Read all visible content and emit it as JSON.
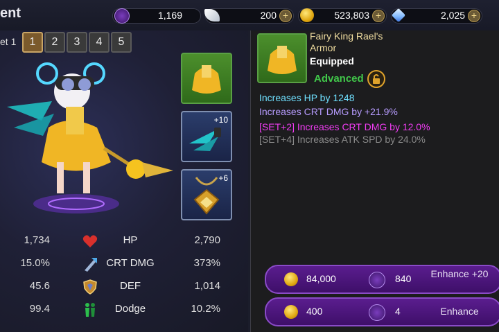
{
  "header": {
    "title": "ent",
    "currencies": [
      {
        "name": "armor-token",
        "value": "1,169",
        "has_plus": false
      },
      {
        "name": "feather",
        "value": "200",
        "has_plus": true
      },
      {
        "name": "gold",
        "value": "523,803",
        "has_plus": true
      },
      {
        "name": "diamond",
        "value": "2,025",
        "has_plus": true
      }
    ],
    "plus_label": "+"
  },
  "sets": {
    "label": "et 1",
    "buttons": [
      "1",
      "2",
      "3",
      "4",
      "5"
    ],
    "active": "1"
  },
  "slots": [
    {
      "name": "armor-slot",
      "level": ""
    },
    {
      "name": "wings-slot",
      "level": "+10"
    },
    {
      "name": "necklace-slot",
      "level": "+6"
    }
  ],
  "stats": [
    {
      "icon": "heart-icon",
      "left": "1,734",
      "label": "HP",
      "right": "2,790"
    },
    {
      "icon": "crit-damage-icon",
      "left": "15.0%",
      "label": "CRT DMG",
      "right": "373%"
    },
    {
      "icon": "shield-icon",
      "left": "45.6",
      "label": "DEF",
      "right": "1,014"
    },
    {
      "icon": "dodge-icon",
      "left": "99.4",
      "label": "Dodge",
      "right": "10.2%"
    }
  ],
  "item": {
    "name": "Fairy King Rael's Armor",
    "state": "Equipped",
    "grade": "Advanced",
    "effects": [
      {
        "text": "Increases HP by 1248",
        "color": "#6fe0ff"
      },
      {
        "text": "Increases CRT DMG by +21.9%",
        "color": "#b79cff"
      },
      {
        "text": "[SET+2] Increases CRT DMG by 12.0%",
        "color": "#f03cf2"
      },
      {
        "text": "[SET+4] Increases ATK SPD by 24.0%",
        "color": "#8a8a8a"
      }
    ]
  },
  "actions": [
    {
      "gold": "84,000",
      "material": "840",
      "label": "Enhance +20"
    },
    {
      "gold": "400",
      "material": "4",
      "label": "Enhance"
    }
  ],
  "colors": {
    "accent_purple": "#5a1d8e",
    "advanced_green": "#41c84a",
    "name_gold": "#f0dda0"
  }
}
